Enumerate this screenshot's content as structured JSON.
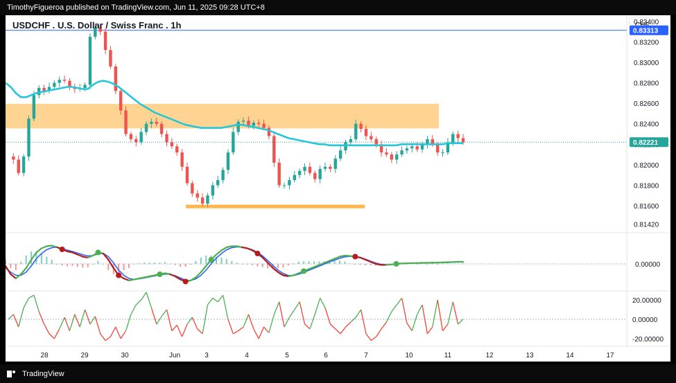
{
  "header": {
    "publisher_text": "TimothyFigueroa published on TradingView.com, Jun 11, 2025 09:28 UTC+8"
  },
  "footer": {
    "brand": "TradingView",
    "logo_icon": "tradingview-logo-icon"
  },
  "chart_data": {
    "type": "candlestick",
    "title": "USDCHF . U.S. Dollar / Swiss Franc . 1h",
    "currency_label": "CHF",
    "colors": {
      "up": "#26a69a",
      "down": "#ef5350",
      "ma": "#26c6da",
      "zone": "#ffcc80",
      "support": "#ffb74d"
    },
    "price_axis": {
      "ticks": [
        "0.83400",
        "0.83200",
        "0.83000",
        "0.82800",
        "0.82600",
        "0.82400",
        "0.82200",
        "0.82000",
        "0.81800",
        "0.81600",
        "0.81420"
      ],
      "range": [
        0.8135,
        0.8346
      ]
    },
    "horizontal_line": {
      "price": 0.83313,
      "label": "0.83313",
      "color": "#2962ff"
    },
    "last_price": {
      "price": 0.82221,
      "label": "0.82221"
    },
    "resistance_zone": {
      "from": 0.82355,
      "to": 0.82595
    },
    "support_zone": {
      "from": 0.81575,
      "to": 0.8161
    },
    "x_axis": {
      "labels": [
        "28",
        "29",
        "30",
        "Jun",
        "3",
        "4",
        "5",
        "6",
        "7",
        "10",
        "11",
        "12",
        "13",
        "14",
        "17"
      ]
    },
    "ohlc_path": [
      0.8208,
      0.8205,
      0.8192,
      0.8208,
      0.8245,
      0.8268,
      0.8275,
      0.8272,
      0.8276,
      0.828,
      0.8283,
      0.8282,
      0.8276,
      0.8274,
      0.8275,
      0.8278,
      0.8325,
      0.8334,
      0.833,
      0.8312,
      0.8296,
      0.8272,
      0.8253,
      0.823,
      0.8225,
      0.8222,
      0.8232,
      0.824,
      0.8242,
      0.824,
      0.823,
      0.8222,
      0.8218,
      0.8212,
      0.8198,
      0.8182,
      0.8172,
      0.8168,
      0.8162,
      0.817,
      0.818,
      0.8185,
      0.8195,
      0.8212,
      0.8232,
      0.8242,
      0.8243,
      0.8238,
      0.8241,
      0.824,
      0.8236,
      0.8228,
      0.8202,
      0.818,
      0.818,
      0.8185,
      0.819,
      0.8194,
      0.8198,
      0.8192,
      0.8186,
      0.8196,
      0.8198,
      0.8196,
      0.8206,
      0.8214,
      0.8222,
      0.8225,
      0.824,
      0.8235,
      0.8228,
      0.8225,
      0.822,
      0.8212,
      0.821,
      0.8205,
      0.821,
      0.8214,
      0.8216,
      0.8218,
      0.8215,
      0.822,
      0.8225,
      0.822,
      0.8212,
      0.8212,
      0.8222,
      0.823,
      0.8226,
      0.8222
    ],
    "ma_path": [
      0.828,
      0.8276,
      0.827,
      0.8266,
      0.8266,
      0.8268,
      0.827,
      0.8271,
      0.8272,
      0.8273,
      0.8274,
      0.8275,
      0.8276,
      0.8276,
      0.8275,
      0.8274,
      0.8274,
      0.8278,
      0.8281,
      0.8282,
      0.8281,
      0.8279,
      0.8276,
      0.8272,
      0.8268,
      0.8264,
      0.826,
      0.8257,
      0.8254,
      0.8251,
      0.8249,
      0.8247,
      0.8245,
      0.8243,
      0.8241,
      0.8239,
      0.8238,
      0.8237,
      0.8236,
      0.8236,
      0.8236,
      0.8236,
      0.8236,
      0.8237,
      0.8238,
      0.8239,
      0.8239,
      0.8238,
      0.8237,
      0.8236,
      0.8235,
      0.8234,
      0.8232,
      0.823,
      0.8228,
      0.8226,
      0.8225,
      0.8224,
      0.8223,
      0.8222,
      0.8221,
      0.822,
      0.822,
      0.8219,
      0.8219,
      0.8219,
      0.8219,
      0.8219,
      0.8219,
      0.8219,
      0.8219,
      0.8219,
      0.8219,
      0.8219,
      0.8219,
      0.8219,
      0.8219,
      0.822,
      0.822,
      0.822,
      0.822,
      0.822,
      0.822,
      0.822,
      0.822,
      0.822,
      0.8221,
      0.8221,
      0.8221,
      0.8221
    ],
    "oscillator_1": {
      "zero_label": "0.00000",
      "fast": [
        -0.1,
        -0.5,
        -0.7,
        -0.5,
        -0.2,
        0.2,
        0.55,
        0.75,
        0.85,
        0.88,
        0.8,
        0.7,
        0.6,
        0.55,
        0.45,
        0.35,
        0.3,
        0.4,
        0.55,
        0.5,
        0.2,
        -0.2,
        -0.55,
        -0.7,
        -0.8,
        -0.75,
        -0.7,
        -0.65,
        -0.6,
        -0.55,
        -0.5,
        -0.45,
        -0.5,
        -0.6,
        -0.75,
        -0.85,
        -0.8,
        -0.65,
        -0.4,
        -0.1,
        0.2,
        0.45,
        0.65,
        0.8,
        0.85,
        0.85,
        0.8,
        0.75,
        0.65,
        0.5,
        0.3,
        0.05,
        -0.2,
        -0.4,
        -0.55,
        -0.6,
        -0.55,
        -0.45,
        -0.35,
        -0.25,
        -0.15,
        -0.05,
        0.05,
        0.15,
        0.25,
        0.35,
        0.4,
        0.38,
        0.35,
        0.3,
        0.2,
        0.1,
        0.0,
        -0.05,
        -0.05,
        -0.03,
        0.0,
        0.02,
        0.03,
        0.04,
        0.04,
        0.05,
        0.05,
        0.06,
        0.06,
        0.07,
        0.08,
        0.09,
        0.1,
        0.1
      ],
      "slow": [
        -0.2,
        -0.4,
        -0.55,
        -0.55,
        -0.4,
        -0.1,
        0.25,
        0.5,
        0.68,
        0.78,
        0.8,
        0.74,
        0.66,
        0.6,
        0.52,
        0.44,
        0.38,
        0.4,
        0.48,
        0.5,
        0.35,
        0.05,
        -0.3,
        -0.55,
        -0.7,
        -0.75,
        -0.72,
        -0.68,
        -0.63,
        -0.58,
        -0.53,
        -0.49,
        -0.5,
        -0.57,
        -0.68,
        -0.78,
        -0.8,
        -0.72,
        -0.55,
        -0.3,
        0.0,
        0.28,
        0.5,
        0.68,
        0.78,
        0.82,
        0.8,
        0.76,
        0.68,
        0.56,
        0.38,
        0.16,
        -0.08,
        -0.3,
        -0.46,
        -0.56,
        -0.56,
        -0.5,
        -0.41,
        -0.31,
        -0.21,
        -0.11,
        -0.01,
        0.09,
        0.18,
        0.27,
        0.34,
        0.36,
        0.35,
        0.31,
        0.23,
        0.13,
        0.04,
        -0.02,
        -0.04,
        -0.03,
        -0.01,
        0.01,
        0.02,
        0.03,
        0.04,
        0.04,
        0.05,
        0.05,
        0.06,
        0.06,
        0.07,
        0.08,
        0.09,
        0.09
      ],
      "markers": [
        {
          "i": 11,
          "kind": "down"
        },
        {
          "i": 18,
          "kind": "up"
        },
        {
          "i": 22,
          "kind": "down"
        },
        {
          "i": 30,
          "kind": "up"
        },
        {
          "i": 35,
          "kind": "down"
        },
        {
          "i": 40,
          "kind": "up"
        },
        {
          "i": 49,
          "kind": "down"
        },
        {
          "i": 58,
          "kind": "up"
        },
        {
          "i": 68,
          "kind": "down"
        },
        {
          "i": 76,
          "kind": "up"
        }
      ]
    },
    "oscillator_2": {
      "ticks": [
        "20.00000",
        "0.00000",
        "-20.00000"
      ],
      "range": [
        -28,
        28
      ],
      "values": [
        0,
        5,
        -8,
        12,
        22,
        25,
        8,
        -5,
        -15,
        -20,
        -10,
        2,
        -12,
        5,
        -8,
        10,
        -5,
        3,
        -15,
        -22,
        -18,
        -8,
        -20,
        -12,
        5,
        15,
        20,
        28,
        12,
        -5,
        3,
        10,
        -12,
        -6,
        -18,
        -5,
        2,
        -10,
        -15,
        15,
        22,
        18,
        25,
        0,
        -15,
        -12,
        -8,
        5,
        -10,
        -20,
        -8,
        -14,
        5,
        18,
        -8,
        2,
        10,
        18,
        -5,
        -10,
        5,
        22,
        12,
        -5,
        -10,
        -15,
        -8,
        -3,
        2,
        10,
        -15,
        -22,
        -18,
        -10,
        -3,
        8,
        15,
        22,
        -4,
        -12,
        5,
        15,
        -15,
        -8,
        20,
        -12,
        -5,
        18,
        -5,
        0
      ]
    }
  }
}
